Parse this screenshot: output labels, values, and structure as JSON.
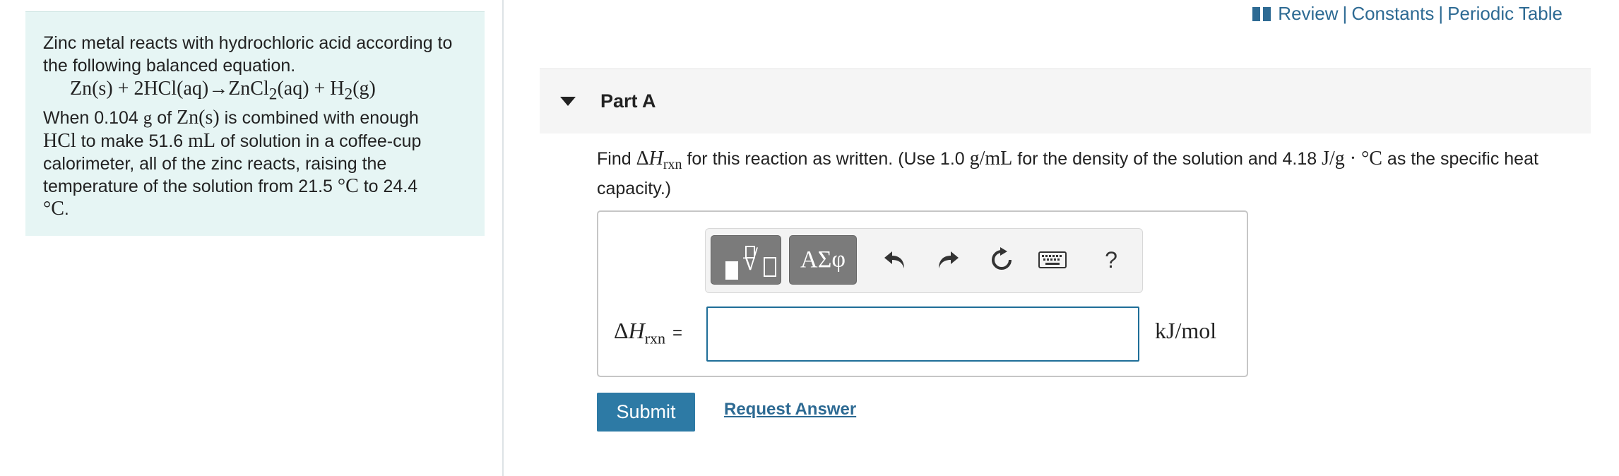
{
  "problem": {
    "intro": "Zinc metal reacts with hydrochloric acid according to the following balanced equation.",
    "equation_lhs": "Zn(s) + 2HCl(aq)",
    "equation_arrow": "→",
    "equation_rhs_a": "ZnCl",
    "equation_rhs_a_sub": "2",
    "equation_rhs_b": "(aq) + H",
    "equation_rhs_b_sub": "2",
    "equation_rhs_c": "(g)",
    "line1_a": "When 0.104 ",
    "line1_unit": "g",
    "line1_b": " of ",
    "line1_species": "Zn(s)",
    "line1_c": " is combined with enough",
    "line2_species": "HCl",
    "line2_a": " to make 51.6 ",
    "line2_unit": "mL",
    "line2_b": " of solution in a coffee-cup",
    "line3": "calorimeter, all of the zinc reacts, raising the",
    "line4_a": "temperature of the solution from 21.5 ",
    "line4_unit": "°C",
    "line4_b": " to 24.4",
    "line5_unit": "°C",
    "line5_end": "."
  },
  "toplinks": {
    "review": "Review",
    "sep1": "|",
    "constants": "Constants",
    "sep2": "|",
    "periodic_table": "Periodic Table"
  },
  "part": {
    "title": "Part A"
  },
  "question": {
    "find": "Find ",
    "delta": "Δ",
    "h": "H",
    "sub": "rxn",
    "text_a": " for this reaction as written. (Use 1.0 ",
    "density_unit": "g/mL",
    "text_b": " for the density of the solution and 4.18 ",
    "heat_unit": "J/g · °C",
    "text_c": " as the specific heat capacity.)"
  },
  "toolbar": {
    "greek_label": "ΑΣφ",
    "help_label": "?"
  },
  "answer": {
    "label_delta": "Δ",
    "label_h": "H",
    "label_sub": "rxn",
    "label_eq": "=",
    "value": "",
    "units": "kJ/mol"
  },
  "actions": {
    "submit": "Submit",
    "request_answer": "Request Answer"
  },
  "colors": {
    "link": "#2d6a93",
    "submit_bg": "#2d7aa5",
    "panel_bg": "#e6f5f4",
    "input_border": "#1f6e98"
  }
}
